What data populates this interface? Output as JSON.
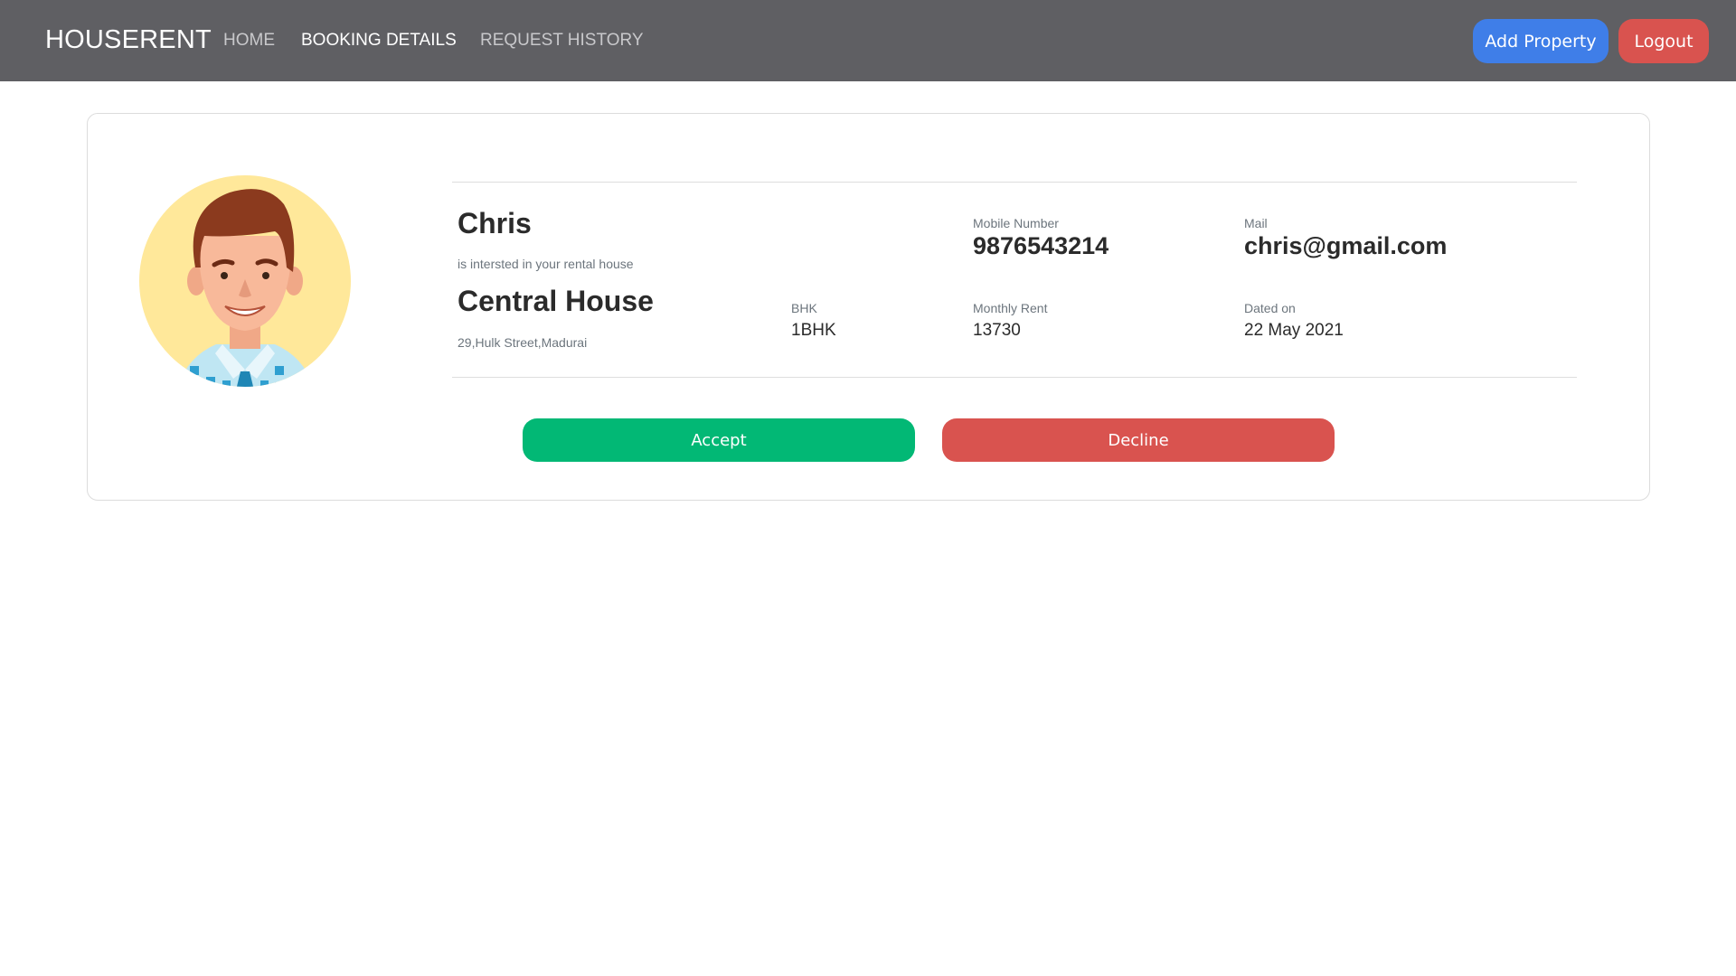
{
  "navbar": {
    "brand": "HOUSERENT",
    "links": [
      {
        "label": "HOME",
        "active": false
      },
      {
        "label": "BOOKING DETAILS",
        "active": true
      },
      {
        "label": "REQUEST HISTORY",
        "active": false
      }
    ],
    "add_property_label": "Add Property",
    "logout_label": "Logout"
  },
  "request": {
    "tenant_name": "Chris",
    "interest_text": "is intersted in your rental house",
    "property_name": "Central House",
    "address": "29,Hulk Street,Madurai",
    "mobile_label": "Mobile Number",
    "mobile_value": "9876543214",
    "mail_label": "Mail",
    "mail_value": "chris@gmail.com",
    "bhk_label": "BHK",
    "bhk_value": "1BHK",
    "rent_label": "Monthly Rent",
    "rent_value": "13730",
    "date_label": "Dated on",
    "date_value": "22 May 2021"
  },
  "actions": {
    "accept_label": "Accept",
    "decline_label": "Decline"
  },
  "colors": {
    "navbar_bg": "#5f5f63",
    "primary": "#3f7ee8",
    "danger": "#d9534f",
    "success": "#02b875",
    "avatar_bg": "#ffe89a"
  },
  "icons": {
    "avatar": "cartoon-man-avatar"
  }
}
